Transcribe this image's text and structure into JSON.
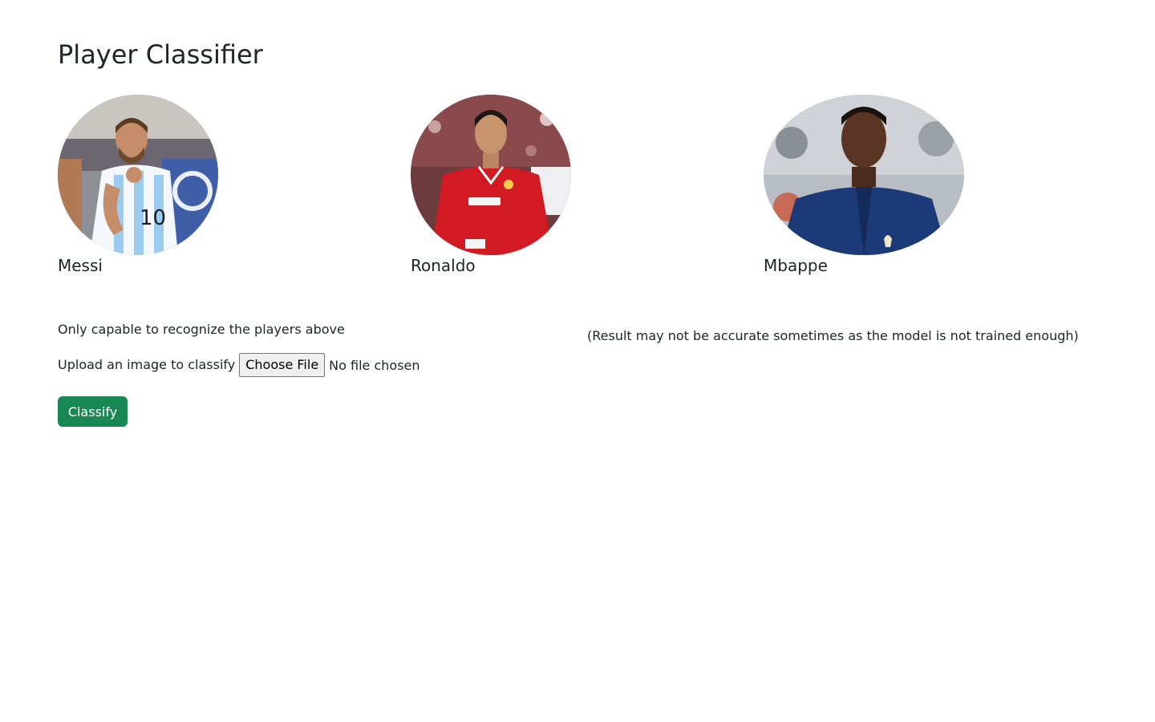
{
  "page": {
    "title": "Player Classifier"
  },
  "players": [
    {
      "name": "Messi",
      "kit": "Argentina home shirt",
      "number": "10"
    },
    {
      "name": "Ronaldo",
      "kit": "Manchester United red shirt"
    },
    {
      "name": "Mbappe",
      "kit": "France navy jacket"
    }
  ],
  "notes": {
    "capability": "Only capable to recognize the players above",
    "disclaimer": "(Result may not be accurate sometimes as the model is not trained enough)"
  },
  "upload": {
    "label": "Upload an image to classify",
    "button_label": "Choose File",
    "status": "No file chosen"
  },
  "actions": {
    "classify_label": "Classify"
  },
  "colors": {
    "primary_success": "#198754",
    "text": "#212529",
    "argentina_blue": "#7fb7e3",
    "united_red": "#d11a22",
    "france_navy": "#1d3a78"
  }
}
